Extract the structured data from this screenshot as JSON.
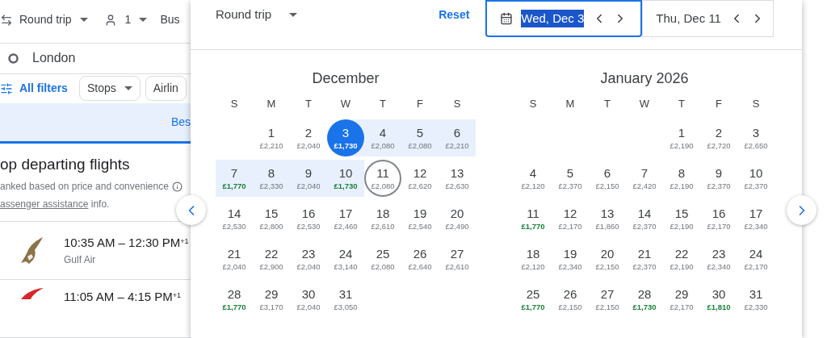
{
  "background_page": {
    "trip_type": "Round trip",
    "passengers": "1",
    "cabin": "Bus",
    "origin": "London",
    "all_filters": "All filters",
    "filter_chips": [
      "Stops",
      "Airlin"
    ],
    "sort_tab": {
      "label": "Bes",
      "selected": true
    },
    "heading": "op departing flights",
    "subtitle": "anked based on price and convenience",
    "assistance_link": "assenger assistance",
    "assistance_suffix": " info.",
    "flights": [
      {
        "times": "10:35 AM – 12:30 PM",
        "day_offset": "+1",
        "airline": "Gulf Air",
        "kind": "bird"
      },
      {
        "times": "11:05 AM – 4:15 PM",
        "day_offset": "+1",
        "kind": "swoosh"
      }
    ]
  },
  "date_picker": {
    "trip_type": "Round trip",
    "reset": "Reset",
    "departure": {
      "value": "Wed, Dec 3",
      "focused": true
    },
    "return": {
      "value": "Thu, Dec 11",
      "focused": false
    },
    "months": [
      {
        "title": "December",
        "weekdays": [
          "S",
          "M",
          "T",
          "W",
          "T",
          "F",
          "S"
        ],
        "weeks": [
          [
            {
              "day": "1",
              "price": "£2,210",
              "cheap": false,
              "selected": false,
              "in_range": false
            },
            {
              "day": "2",
              "price": "£2,040",
              "cheap": false,
              "selected": false,
              "in_range": false
            },
            {
              "day": "3",
              "price": "£1,730",
              "cheap": true,
              "selected": true,
              "in_range": true
            },
            {
              "day": "4",
              "price": "£2,080",
              "cheap": false,
              "selected": false,
              "in_range": true
            },
            {
              "day": "5",
              "price": "£2,080",
              "cheap": false,
              "selected": false,
              "in_range": true
            },
            {
              "day": "6",
              "price": "£2,210",
              "cheap": false,
              "selected": false,
              "in_range": true
            }
          ],
          [
            {
              "day": "7",
              "price": "£1,770",
              "cheap": true,
              "selected": false,
              "in_range": true
            },
            {
              "day": "8",
              "price": "£2,330",
              "cheap": false,
              "selected": false,
              "in_range": true
            },
            {
              "day": "9",
              "price": "£2,040",
              "cheap": false,
              "selected": false,
              "in_range": true
            },
            {
              "day": "10",
              "price": "£1,730",
              "cheap": true,
              "selected": false,
              "in_range": true
            },
            {
              "day": "11",
              "price": "£2,080",
              "cheap": false,
              "selected": true,
              "in_range": false
            },
            {
              "day": "12",
              "price": "£2,620",
              "cheap": false,
              "selected": false,
              "in_range": false
            },
            {
              "day": "13",
              "price": "£2,630",
              "cheap": false,
              "selected": false,
              "in_range": false
            }
          ],
          [
            {
              "day": "14",
              "price": "£2,530",
              "cheap": false,
              "selected": false,
              "in_range": false
            },
            {
              "day": "15",
              "price": "£2,800",
              "cheap": false,
              "selected": false,
              "in_range": false
            },
            {
              "day": "16",
              "price": "£2,530",
              "cheap": false,
              "selected": false,
              "in_range": false
            },
            {
              "day": "17",
              "price": "£2,460",
              "cheap": false,
              "selected": false,
              "in_range": false
            },
            {
              "day": "18",
              "price": "£2,610",
              "cheap": false,
              "selected": false,
              "in_range": false
            },
            {
              "day": "19",
              "price": "£2,540",
              "cheap": false,
              "selected": false,
              "in_range": false
            },
            {
              "day": "20",
              "price": "£2,490",
              "cheap": false,
              "selected": false,
              "in_range": false
            }
          ],
          [
            {
              "day": "21",
              "price": "£2,040",
              "cheap": false,
              "selected": false,
              "in_range": false
            },
            {
              "day": "22",
              "price": "£2,900",
              "cheap": false,
              "selected": false,
              "in_range": false
            },
            {
              "day": "23",
              "price": "£2,040",
              "cheap": false,
              "selected": false,
              "in_range": false
            },
            {
              "day": "24",
              "price": "£3,140",
              "cheap": false,
              "selected": false,
              "in_range": false
            },
            {
              "day": "25",
              "price": "£2,080",
              "cheap": false,
              "selected": false,
              "in_range": false
            },
            {
              "day": "26",
              "price": "£2,640",
              "cheap": false,
              "selected": false,
              "in_range": false
            },
            {
              "day": "27",
              "price": "£2,610",
              "cheap": false,
              "selected": false,
              "in_range": false
            }
          ],
          [
            {
              "day": "28",
              "price": "£1,770",
              "cheap": true,
              "selected": false,
              "in_range": false
            },
            {
              "day": "29",
              "price": "£3,170",
              "cheap": false,
              "selected": false,
              "in_range": false
            },
            {
              "day": "30",
              "price": "£2,040",
              "cheap": false,
              "selected": false,
              "in_range": false
            },
            {
              "day": "31",
              "price": "£3,050",
              "cheap": false,
              "selected": false,
              "in_range": false
            }
          ]
        ]
      },
      {
        "title": "January 2026",
        "weekdays": [
          "S",
          "M",
          "T",
          "W",
          "T",
          "F",
          "S"
        ],
        "weeks": [
          [
            {
              "day": "1",
              "price": "£2,190",
              "cheap": false,
              "selected": false,
              "in_range": false
            },
            {
              "day": "2",
              "price": "£2,720",
              "cheap": false,
              "selected": false,
              "in_range": false
            },
            {
              "day": "3",
              "price": "£2,650",
              "cheap": false,
              "selected": false,
              "in_range": false
            }
          ],
          [
            {
              "day": "4",
              "price": "£2,120",
              "cheap": false,
              "selected": false,
              "in_range": false
            },
            {
              "day": "5",
              "price": "£2,370",
              "cheap": false,
              "selected": false,
              "in_range": false
            },
            {
              "day": "6",
              "price": "£2,150",
              "cheap": false,
              "selected": false,
              "in_range": false
            },
            {
              "day": "7",
              "price": "£2,420",
              "cheap": false,
              "selected": false,
              "in_range": false
            },
            {
              "day": "8",
              "price": "£2,190",
              "cheap": false,
              "selected": false,
              "in_range": false
            },
            {
              "day": "9",
              "price": "£2,370",
              "cheap": false,
              "selected": false,
              "in_range": false
            },
            {
              "day": "10",
              "price": "£2,370",
              "cheap": false,
              "selected": false,
              "in_range": false
            }
          ],
          [
            {
              "day": "11",
              "price": "£1,770",
              "cheap": true,
              "selected": false,
              "in_range": false
            },
            {
              "day": "12",
              "price": "£2,170",
              "cheap": false,
              "selected": false,
              "in_range": false
            },
            {
              "day": "13",
              "price": "£1,860",
              "cheap": false,
              "selected": false,
              "in_range": false
            },
            {
              "day": "14",
              "price": "£2,370",
              "cheap": false,
              "selected": false,
              "in_range": false
            },
            {
              "day": "15",
              "price": "£2,190",
              "cheap": false,
              "selected": false,
              "in_range": false
            },
            {
              "day": "16",
              "price": "£2,170",
              "cheap": false,
              "selected": false,
              "in_range": false
            },
            {
              "day": "17",
              "price": "£2,340",
              "cheap": false,
              "selected": false,
              "in_range": false
            }
          ],
          [
            {
              "day": "18",
              "price": "£2,120",
              "cheap": false,
              "selected": false,
              "in_range": false
            },
            {
              "day": "19",
              "price": "£2,340",
              "cheap": false,
              "selected": false,
              "in_range": false
            },
            {
              "day": "20",
              "price": "£2,150",
              "cheap": false,
              "selected": false,
              "in_range": false
            },
            {
              "day": "21",
              "price": "£2,370",
              "cheap": false,
              "selected": false,
              "in_range": false
            },
            {
              "day": "22",
              "price": "£2,190",
              "cheap": false,
              "selected": false,
              "in_range": false
            },
            {
              "day": "23",
              "price": "£2,340",
              "cheap": false,
              "selected": false,
              "in_range": false
            },
            {
              "day": "24",
              "price": "£2,170",
              "cheap": false,
              "selected": false,
              "in_range": false
            }
          ],
          [
            {
              "day": "25",
              "price": "£1,770",
              "cheap": true,
              "selected": false,
              "in_range": false
            },
            {
              "day": "26",
              "price": "£2,150",
              "cheap": false,
              "selected": false,
              "in_range": false
            },
            {
              "day": "27",
              "price": "£2,150",
              "cheap": false,
              "selected": false,
              "in_range": false
            },
            {
              "day": "28",
              "price": "£1,730",
              "cheap": true,
              "selected": false,
              "in_range": false
            },
            {
              "day": "29",
              "price": "£2,170",
              "cheap": false,
              "selected": false,
              "in_range": false
            },
            {
              "day": "30",
              "price": "£1,810",
              "cheap": true,
              "selected": false,
              "in_range": false
            },
            {
              "day": "31",
              "price": "£2,330",
              "cheap": false,
              "selected": false,
              "in_range": false
            }
          ]
        ]
      }
    ]
  }
}
